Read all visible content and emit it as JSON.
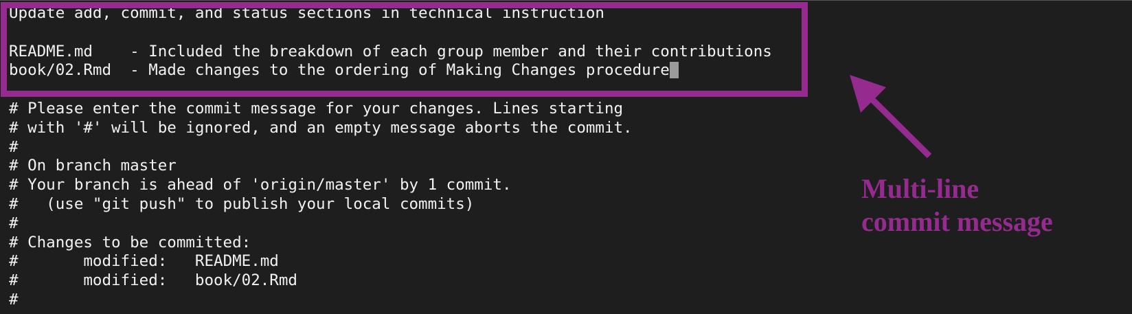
{
  "editor": {
    "lines": [
      "Update add, commit, and status sections in technical instruction",
      "",
      "README.md    - Included the breakdown of each group member and their contributions",
      "book/02.Rmd  - Made changes to the ordering of Making Changes procedure",
      "",
      "# Please enter the commit message for your changes. Lines starting",
      "# with '#' will be ignored, and an empty message aborts the commit.",
      "#",
      "# On branch master",
      "# Your branch is ahead of 'origin/master' by 1 commit.",
      "#   (use \"git push\" to publish your local commits)",
      "#",
      "# Changes to be committed:",
      "#\tmodified:   README.md",
      "#\tmodified:   book/02.Rmd",
      "#"
    ]
  },
  "annotation": {
    "label_line1": "Multi-line",
    "label_line2": "commit message",
    "color": "#952a8f"
  },
  "colors": {
    "background": "#1e1e1e",
    "text": "#f2f2f2",
    "cursor": "#9a9a9a"
  }
}
